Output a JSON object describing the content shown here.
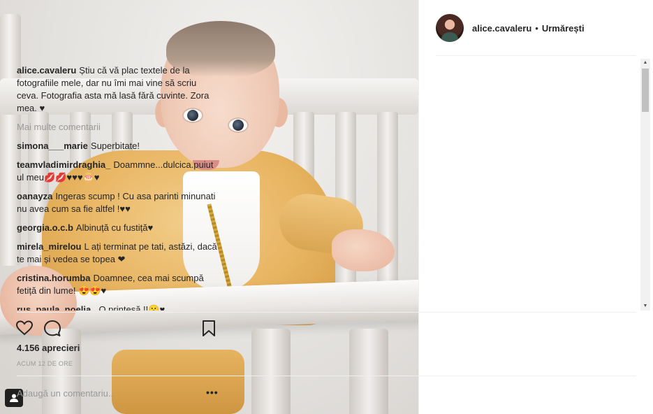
{
  "post": {
    "author": "alice.cavaleru",
    "separator": "•",
    "follow_status": "Urmărești",
    "caption_user": "alice.cavaleru",
    "caption_text": "Știu că vă plac textele de la fotografiile mele, dar nu îmi mai vine să scriu ceva. Fotografia asta mă lasă fără cuvinte. Zora mea. ♥",
    "more_comments": "Mai multe comentarii",
    "likes": "4.156 aprecieri",
    "timestamp": "ACUM 12 DE ORE",
    "add_comment_placeholder": "Adaugă un comentariu...",
    "options": "•••"
  },
  "comments": [
    {
      "user": "simona___marie",
      "text": "Superbitate!"
    },
    {
      "user": "teamvladimirdraghia_",
      "text": "Doammne...dulcica.puiutul meu💋💋♥♥♥🎂♥"
    },
    {
      "user": "oanayza",
      "text": "Ingeras scump ! Cu asa parinti minunati nu avea cum sa fie altfel !♥♥"
    },
    {
      "user": "georgia.o.c.b",
      "text": "Albinuță cu fustiță♥"
    },
    {
      "user": "mirela_mirelou",
      "text": "L ați terminat pe tati, astăzi, dacă te mai și vedea se topea ❤"
    },
    {
      "user": "cristina.horumba",
      "text": "Doamnee, cea mai scumpă fetiță din lume! 😍😍♥"
    },
    {
      "user": "rus_paula_noelia_",
      "text": "O prințesă !!😮♥"
    },
    {
      "user": "",
      "text": ""
    }
  ],
  "icons": {
    "like": "heart-icon",
    "comment": "comment-icon",
    "save": "bookmark-icon",
    "user_tag": "user-icon"
  }
}
